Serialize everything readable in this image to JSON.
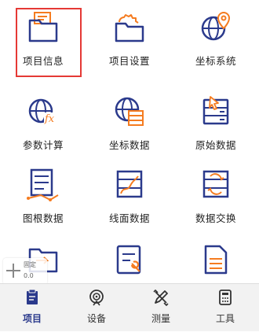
{
  "grid": {
    "items": [
      {
        "label": "项目信息",
        "icon": "project-info-folder-icon"
      },
      {
        "label": "项目设置",
        "icon": "project-settings-gear-folder-icon"
      },
      {
        "label": "坐标系统",
        "icon": "coordinate-system-globe-pin-icon"
      },
      {
        "label": "参数计算",
        "icon": "parameter-calc-globe-fx-icon"
      },
      {
        "label": "坐标数据",
        "icon": "coordinate-data-globe-db-icon"
      },
      {
        "label": "原始数据",
        "icon": "raw-data-db-cursor-icon"
      },
      {
        "label": "图根数据",
        "icon": "control-point-data-icon"
      },
      {
        "label": "线面数据",
        "icon": "line-area-data-icon"
      },
      {
        "label": "数据交换",
        "icon": "data-exchange-icon"
      },
      {
        "label": "",
        "icon": "folder-arrow-icon"
      },
      {
        "label": "",
        "icon": "document-tool-icon"
      },
      {
        "label": "",
        "icon": "document-lines-icon"
      }
    ],
    "selected_index": 0
  },
  "float_widget": {
    "label": "固定",
    "value": "0.0"
  },
  "bottom_nav": {
    "items": [
      {
        "label": "项目",
        "icon": "project-clipboard-icon",
        "active": true
      },
      {
        "label": "设备",
        "icon": "device-signal-icon",
        "active": false
      },
      {
        "label": "测量",
        "icon": "survey-pen-icon",
        "active": false
      },
      {
        "label": "工具",
        "icon": "tools-calculator-icon",
        "active": false
      }
    ]
  },
  "colors": {
    "icon_dark": "#2b3a8c",
    "icon_accent": "#f57c20",
    "selection_border": "#e53935",
    "bottom_bar_bg": "#f2f2f2"
  }
}
